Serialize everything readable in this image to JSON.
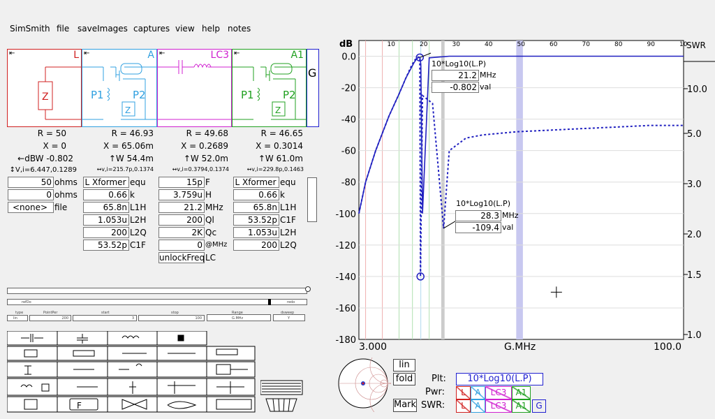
{
  "menu": [
    "SimSmith",
    "file",
    "saveImages",
    "captures",
    "view",
    "help",
    "notes"
  ],
  "components": [
    {
      "label": "L",
      "color": "#d02020",
      "left": 10,
      "width": 106,
      "R": "R = 50",
      "X": "X = 0",
      "extra": "←dBW -0.802",
      "vi": "↕V,i=6.447,0.1289"
    },
    {
      "label": "A",
      "color": "#30a0e0",
      "left": 116,
      "width": 108,
      "R": "R = 46.93",
      "X": "X = 65.06m",
      "extra": "↑W 54.4m",
      "vi": "↔v,i=215.7p,0.1374"
    },
    {
      "label": "LC3",
      "color": "#d020d0",
      "left": 224,
      "width": 107,
      "R": "R = 49.68",
      "X": "X = 0.2689",
      "extra": "↑W 52.0m",
      "vi": "↔v,i=0.3794,0.1374"
    },
    {
      "label": "A1",
      "color": "#20a020",
      "left": 331,
      "width": 107,
      "R": "R = 46.65",
      "X": "X = 0.3014",
      "extra": "↑W 61.0m",
      "vi": "↔v,i=229.8p,0.1463"
    }
  ],
  "g_label": "G",
  "load_fields": [
    {
      "value": "50",
      "unit": "ohms"
    },
    {
      "value": "0",
      "unit": "ohms"
    },
    {
      "value": "<none>",
      "unit": "file"
    }
  ],
  "a_fields": [
    {
      "value": "L Xformer",
      "unit": "equ"
    },
    {
      "value": "0.66",
      "unit": "k"
    },
    {
      "value": "65.8n",
      "unit": "L1H"
    },
    {
      "value": "1.053u",
      "unit": "L2H"
    },
    {
      "value": "200",
      "unit": "L2Q"
    },
    {
      "value": "53.52p",
      "unit": "C1F"
    }
  ],
  "lc3_fields": [
    {
      "value": "15p",
      "unit": "F"
    },
    {
      "value": "3.759u",
      "unit": "H"
    },
    {
      "value": "21.2",
      "unit": "MHz"
    },
    {
      "value": "200",
      "unit": "Ql"
    },
    {
      "value": "2K",
      "unit": "Qc"
    },
    {
      "value": "0",
      "unit": "@MHz"
    },
    {
      "value": "unlockFreq",
      "unit": "LC"
    }
  ],
  "a1_fields": [
    {
      "value": "L Xformer",
      "unit": "equ"
    },
    {
      "value": "0.66",
      "unit": "k"
    },
    {
      "value": "65.8n",
      "unit": "L1H"
    },
    {
      "value": "53.52p",
      "unit": "C1F"
    },
    {
      "value": "1.053u",
      "unit": "L2H"
    },
    {
      "value": "200",
      "unit": "L2Q"
    }
  ],
  "small_panel": {
    "left_label": "refDo",
    "right_label": "redo",
    "type_label": "type",
    "type_value": "lin",
    "points_label": "PointPer",
    "points_value": "200",
    "start_label": "start",
    "start_value": "3",
    "stop_label": "stop",
    "stop_value": "100",
    "range_label": "Range",
    "range_value": "G.MHz",
    "sweep_label": "dsweep",
    "sweep_value": "Y"
  },
  "chart": {
    "left_title": "dB",
    "right_title": "SWR",
    "top_ticks": [
      "10",
      "20",
      "30",
      "40",
      "50",
      "60",
      "70",
      "80",
      "90",
      "10"
    ],
    "y_ticks": [
      "0.0",
      "-20",
      "-40",
      "-60",
      "-80",
      "-100",
      "-120",
      "-140",
      "-160",
      "-180"
    ],
    "swr_ticks": [
      "10.0",
      "5.0",
      "3.0",
      "2.0",
      "1.5",
      "1.0"
    ],
    "x_left": "3.000",
    "x_mid": "G.MHz",
    "x_right": "100.0",
    "marker1": {
      "label": "10*Log10(L.P)",
      "freq": "21.2",
      "freq_unit": "MHz",
      "val": "-0.802",
      "val_unit": "val"
    },
    "marker2": {
      "label": "10*Log10(L.P)",
      "freq": "28.3",
      "freq_unit": "MHz",
      "val": "-109.4",
      "val_unit": "val"
    }
  },
  "chart_data": {
    "type": "line",
    "xlabel": "G.MHz",
    "xlim": [
      3,
      100
    ],
    "ylim": [
      -180,
      10
    ],
    "series": [
      {
        "name": "10*Log10(L.P)",
        "x": [
          3,
          5,
          8,
          12,
          15,
          17,
          18.5,
          19.5,
          20.3,
          20.8,
          21.0,
          21.2,
          21.5,
          22,
          24,
          30,
          50,
          70,
          100
        ],
        "y": [
          -100,
          -80,
          -60,
          -38,
          -24,
          -14,
          -8,
          -4,
          -1.5,
          -0.8,
          -0.8,
          -0.8,
          -5,
          -100,
          -1,
          0,
          0,
          0,
          0
        ]
      },
      {
        "x": [
          3,
          5,
          8,
          12,
          15,
          17,
          18.5,
          19.5,
          20.3,
          20.8,
          21.2,
          21.4,
          22,
          25,
          28.3,
          30,
          35,
          40,
          50,
          60,
          70,
          80,
          90,
          100
        ],
        "y": [
          -100,
          -80,
          -60,
          -38,
          -24,
          -14,
          -7,
          -3,
          -1,
          -0.6,
          -0.8,
          -140,
          -25,
          -30,
          -109.4,
          -60,
          -52,
          -50,
          -48,
          -47,
          -46,
          -45,
          -44,
          -44
        ]
      }
    ]
  },
  "bottom": {
    "lin": "lin",
    "fold": "fold",
    "mark": "Mark",
    "plt_label": "Plt:",
    "plt_value": "10*Log10(L.P)",
    "pwr_label": "Pwr:",
    "swr_label": "SWR:",
    "segments": [
      "L",
      "A",
      "LC3",
      "A1"
    ],
    "g": "G"
  }
}
